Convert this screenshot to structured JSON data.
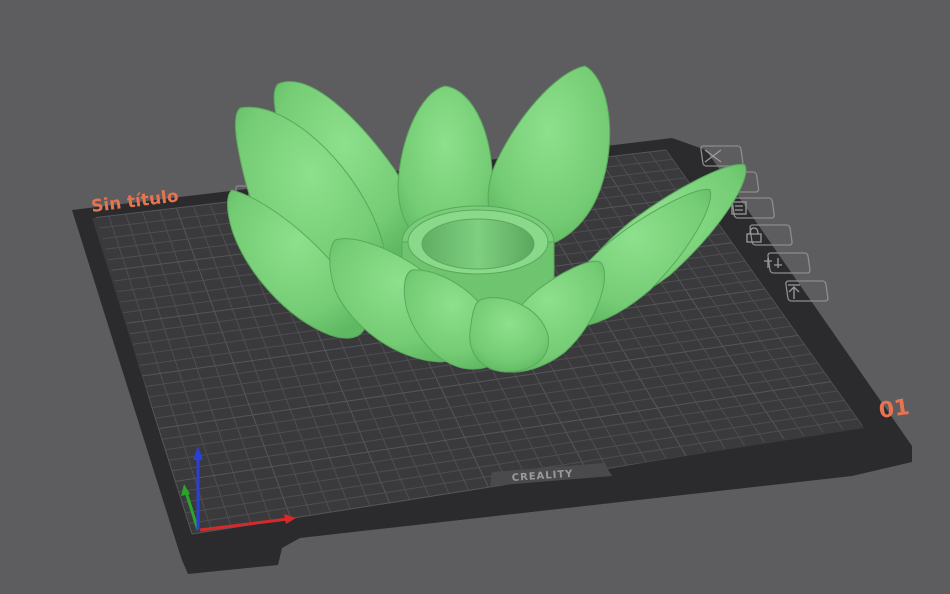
{
  "plate": {
    "name": "Sin título",
    "number": "01",
    "brand": "CREALITY"
  },
  "plate_buttons": [
    {
      "name": "delete-plate-button",
      "icon": "close-icon"
    },
    {
      "name": "auto-orient-button",
      "icon": "orient-icon"
    },
    {
      "name": "arrange-button",
      "icon": "arrange-icon"
    },
    {
      "name": "lock-plate-button",
      "icon": "lock-icon"
    },
    {
      "name": "plate-settings-button",
      "icon": "settings-icon"
    },
    {
      "name": "slice-plate-button",
      "icon": "upload-icon"
    }
  ],
  "colors": {
    "background": "#5d5d5f",
    "plate_frame": "#2c2c2e",
    "plate_surface": "#3a3a3d",
    "grid": "#4d4d51",
    "model": "#7fd37f",
    "accent": "#e8734f",
    "axis_x": "#d42a2a",
    "axis_y": "#2aa52a",
    "axis_z": "#2a3fd4"
  }
}
